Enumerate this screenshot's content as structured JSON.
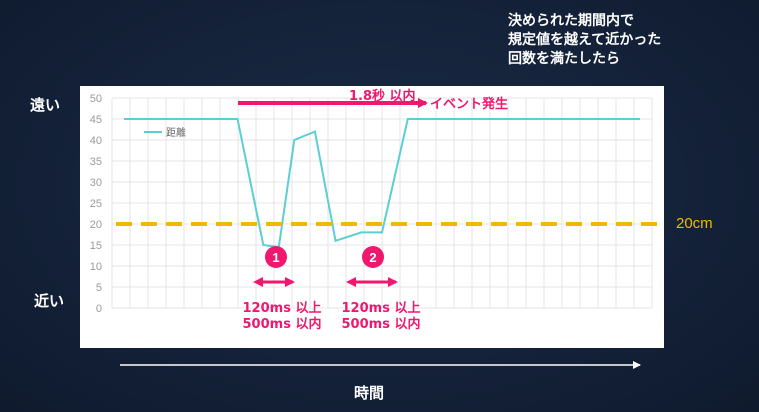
{
  "annotation": {
    "line1": "決められた期間内で",
    "line2": "規定値を越えて近かった",
    "line3": "回数を満たしたら"
  },
  "labels": {
    "far": "遠い",
    "near": "近い",
    "time": "時間",
    "threshold": "20cm",
    "window": "1.8秒 以内",
    "event": "イベント発生",
    "step1": "1",
    "step2": "2",
    "range1_line1": "120ms 以上",
    "range1_line2": "500ms 以内",
    "range2_line1": "120ms 以上",
    "range2_line2": "500ms 以内"
  },
  "colors": {
    "series": "#5bcfd4",
    "threshold": "#f0b800",
    "accent": "#f0176f",
    "grid": "#e4e4e4",
    "axis_text": "#9a9a9a"
  },
  "chart_data": {
    "type": "line",
    "ylim": [
      0,
      50
    ],
    "yticks": [
      0,
      5,
      10,
      15,
      20,
      25,
      30,
      35,
      40,
      45,
      50
    ],
    "xlim": [
      0,
      100
    ],
    "series": [
      {
        "name": "距離",
        "x": [
          0,
          22,
          27,
          30,
          33,
          37,
          41,
          46,
          50,
          55,
          59,
          100
        ],
        "y": [
          45,
          45,
          15,
          14.5,
          40,
          42,
          16,
          18,
          18,
          45,
          45,
          45
        ]
      }
    ],
    "threshold": 20,
    "grid": true,
    "legend": "top-left"
  }
}
